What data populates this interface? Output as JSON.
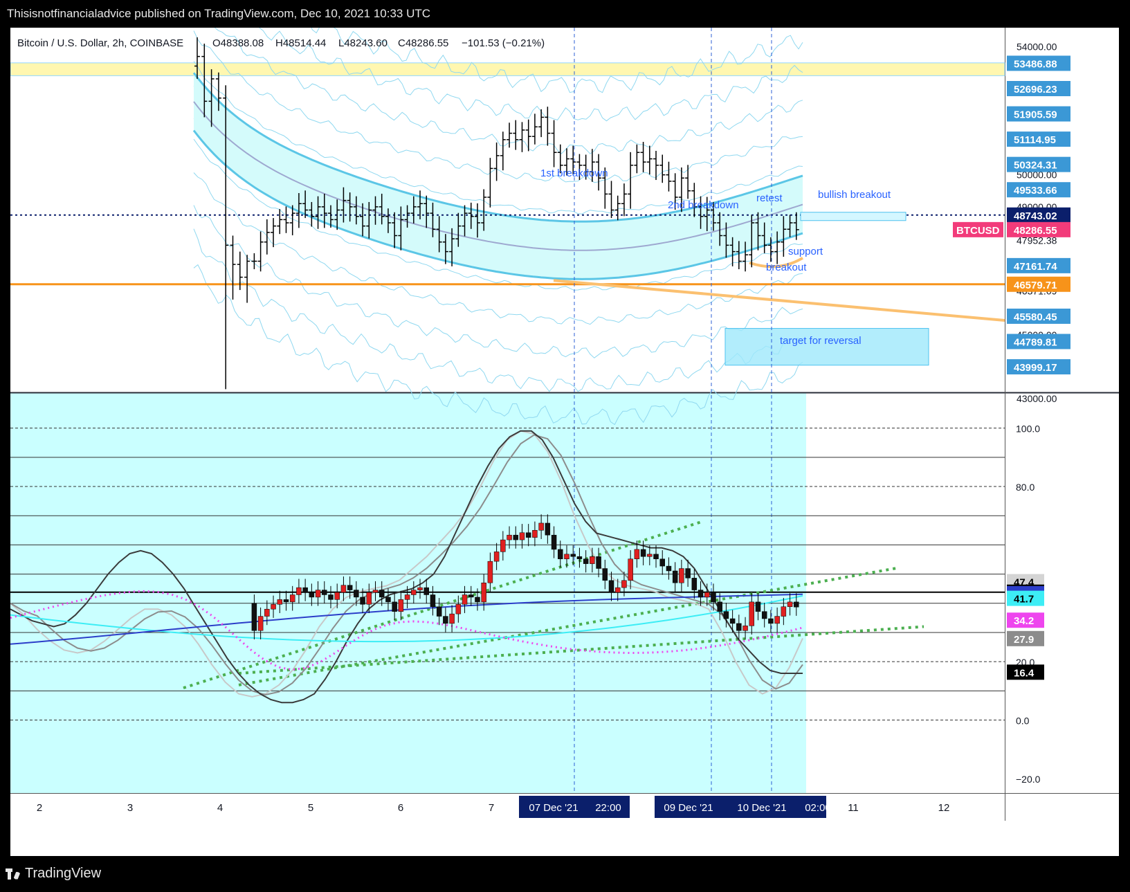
{
  "header": {
    "title": "Thisisnotfinancialadvice published on TradingView.com, Dec 10, 2021 10:33 UTC"
  },
  "footer": {
    "brand": "TradingView"
  },
  "chart_data": [
    {
      "type": "candlestick",
      "pane": "price",
      "title": "Bitcoin / U.S. Dollar, 2h, COINBASE",
      "ohlc": {
        "open": "48388.08",
        "high": "48514.44",
        "low": "48243.60",
        "close": "48286.55",
        "change": "−101.53 (−0.21%)"
      },
      "symbol": "BTCUSD",
      "last_price": "48286.55",
      "ylim": [
        43200,
        54600
      ],
      "y_tick_labels": [
        "54000.00",
        "50000.00",
        "49000.00",
        "47952.38",
        "46371.09",
        "45000.00",
        "43000.00"
      ],
      "price_labels": [
        {
          "value": 53486.88,
          "text": "53486.88",
          "color": "#3b98d6"
        },
        {
          "value": 52696.23,
          "text": "52696.23",
          "color": "#3b98d6"
        },
        {
          "value": 51905.59,
          "text": "51905.59",
          "color": "#3b98d6"
        },
        {
          "value": 51114.95,
          "text": "51114.95",
          "color": "#3b98d6"
        },
        {
          "value": 50324.31,
          "text": "50324.31",
          "color": "#3b98d6"
        },
        {
          "value": 49533.66,
          "text": "49533.66",
          "color": "#3b98d6"
        },
        {
          "value": 48743.02,
          "text": "48743.02",
          "color": "#0b1f6b"
        },
        {
          "value": 48286.55,
          "text": "48286.55",
          "color": "#f23b7a"
        },
        {
          "value": 47161.74,
          "text": "47161.74",
          "color": "#3b98d6"
        },
        {
          "value": 46579.71,
          "text": "46579.71",
          "color": "#f7931a"
        },
        {
          "value": 45580.45,
          "text": "45580.45",
          "color": "#3b98d6"
        },
        {
          "value": 44789.81,
          "text": "44789.81",
          "color": "#3b98d6"
        },
        {
          "value": 43999.17,
          "text": "43999.17",
          "color": "#3b98d6"
        }
      ],
      "annotations": [
        "1st breakdown",
        "2nd breakdown",
        "retest",
        "bullish breakout",
        "support",
        "breakout",
        "target for reversal"
      ],
      "candles_start": [
        [
          53400,
          54300,
          53000,
          53700
        ],
        [
          53700,
          54100,
          51800,
          52300
        ],
        [
          52300,
          53300,
          51500,
          53000
        ],
        [
          53000,
          53200,
          52000,
          52400
        ],
        [
          52400,
          52800,
          43300,
          47800
        ],
        [
          47800,
          48100,
          46100,
          47200
        ],
        [
          47200,
          47600,
          46400,
          46800
        ],
        [
          46800,
          47500,
          46000,
          47300
        ]
      ],
      "close_series": [
        47300,
        47900,
        48200,
        48400,
        48600,
        48500,
        48800,
        49100,
        48900,
        48700,
        49000,
        48800,
        48600,
        48900,
        49200,
        49000,
        48700,
        48400,
        48900,
        49000,
        48700,
        48500,
        48100,
        48600,
        48800,
        49000,
        49100,
        48800,
        48300,
        47900,
        47600,
        48000,
        48400,
        48800,
        48700,
        48500,
        49300,
        50200,
        50600,
        51100,
        51300,
        51100,
        51400,
        51200,
        51500,
        51800,
        51300,
        50700,
        50300,
        50500,
        50400,
        50300,
        50100,
        50400,
        49900,
        49400,
        48900,
        49100,
        49400,
        50300,
        50700,
        50400,
        50500,
        50300,
        50000,
        49800,
        49300,
        49900,
        49500,
        49000,
        48700,
        48900,
        48500,
        48100,
        47800,
        47600,
        47300,
        47500,
        48500,
        48100,
        47800,
        47600,
        47900,
        48300,
        48500,
        48286
      ],
      "x_tick_labels": [
        "2",
        "3",
        "4",
        "5",
        "6",
        "7",
        "07 Dec '21",
        "22:00",
        "09 Dec '21",
        "10 Dec '21",
        "02:00",
        "11",
        "12"
      ]
    },
    {
      "type": "line",
      "pane": "oscillator",
      "ylim": [
        -25,
        112
      ],
      "y_tick_labels": [
        "100.0",
        "80.0",
        "20.0",
        "0.0",
        "-20.0"
      ],
      "level_labels": [
        {
          "value": 47.4,
          "text": "47.4",
          "bg": "#d4d4d4",
          "fg": "#000000"
        },
        {
          "value": 43.8,
          "text": "43.8",
          "bg": "#000000",
          "fg": "#ffffff"
        },
        {
          "value": 43.3,
          "text": "43.3",
          "bg": "#2c3ec9",
          "fg": "#ffffff"
        },
        {
          "value": 41.7,
          "text": "41.7",
          "bg": "#3dedf5",
          "fg": "#000000"
        },
        {
          "value": 34.2,
          "text": "34.2",
          "bg": "#ee45ee",
          "fg": "#ffffff"
        },
        {
          "value": 27.9,
          "text": "27.9",
          "bg": "#8c8c8c",
          "fg": "#ffffff"
        },
        {
          "value": 16.4,
          "text": "16.4",
          "bg": "#000000",
          "fg": "#ffffff"
        }
      ],
      "reference_levels": [
        100,
        90,
        80,
        70,
        60,
        50,
        43.8,
        40,
        30,
        20,
        10,
        0
      ],
      "series": [
        {
          "values": [
            38,
            36,
            34,
            33,
            32,
            33,
            36,
            40,
            45,
            50,
            54,
            57,
            58,
            57,
            54,
            50,
            45,
            39,
            33,
            27,
            21,
            16,
            12,
            9,
            7,
            6,
            6,
            7,
            9,
            14,
            20,
            27,
            33,
            38,
            41,
            43,
            44,
            45,
            47,
            50,
            56,
            64,
            72,
            80,
            87,
            93,
            97,
            99,
            99,
            96,
            90,
            82,
            74,
            68,
            64,
            63,
            62,
            61,
            60,
            59,
            59,
            58,
            56,
            52,
            46,
            40,
            34,
            28,
            24,
            20,
            17,
            16,
            16,
            16
          ]
        },
        {
          "values": [
            40,
            36,
            31,
            27,
            24,
            23,
            24,
            27,
            31,
            35,
            38,
            38,
            36,
            32,
            26,
            19,
            13,
            9,
            8,
            9,
            12,
            17,
            24,
            32,
            38,
            42,
            44,
            45,
            46,
            48,
            52,
            56,
            61,
            66,
            72,
            80,
            89,
            96,
            99,
            98,
            92,
            82,
            70,
            60,
            52,
            48,
            46,
            45,
            44,
            42,
            41,
            40,
            38,
            30,
            20,
            12,
            9,
            11,
            18,
            28
          ]
        }
      ]
    }
  ]
}
